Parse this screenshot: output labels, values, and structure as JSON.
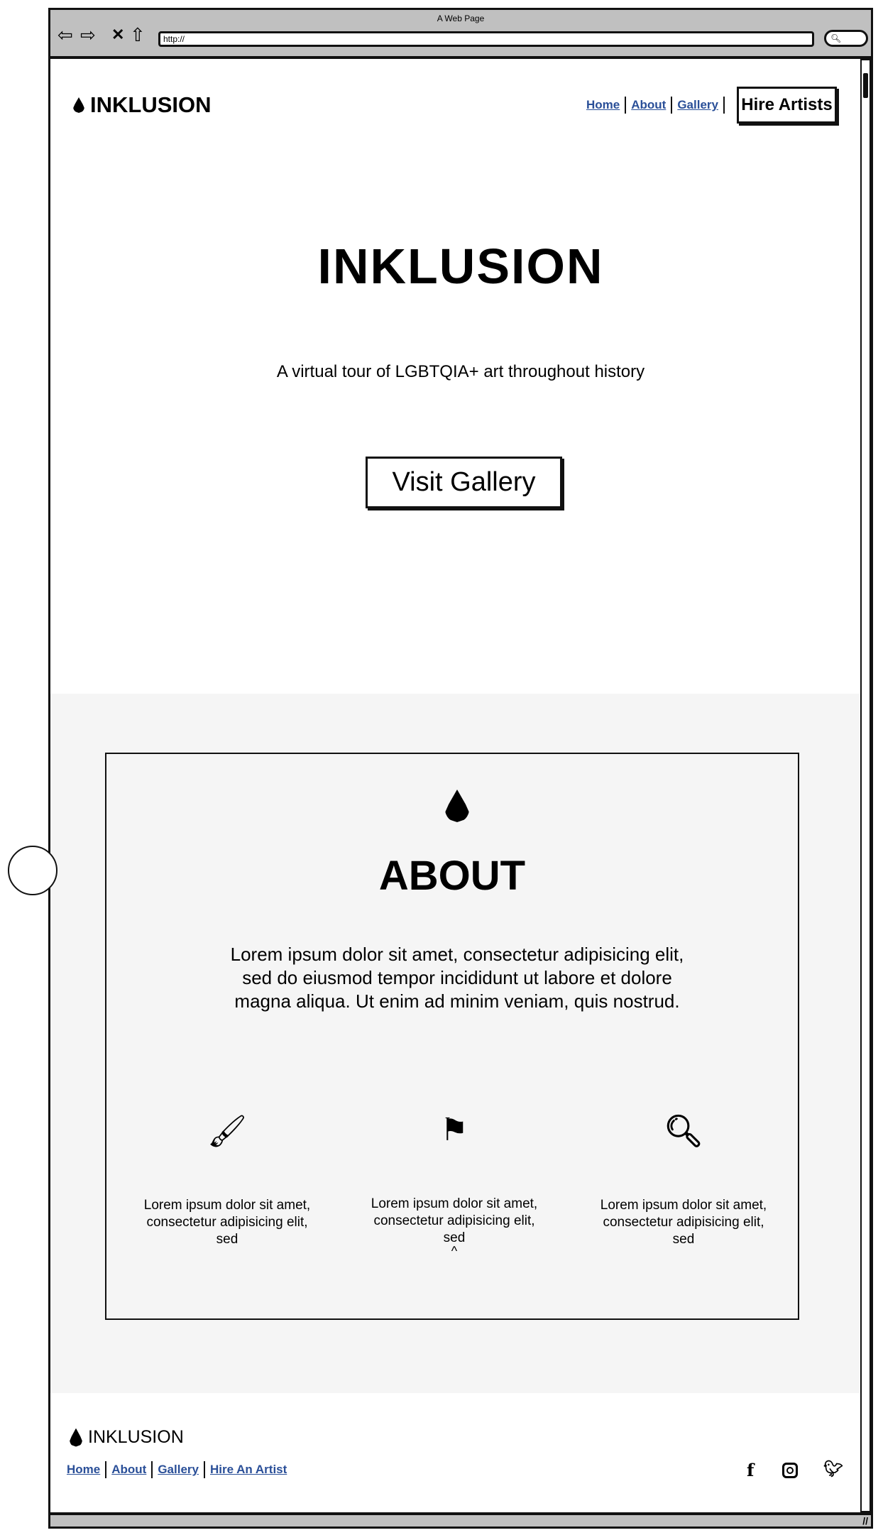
{
  "browser": {
    "title": "A Web Page",
    "url": "http://"
  },
  "header": {
    "logo": "INKLUSION",
    "nav": [
      "Home",
      "About",
      "Gallery"
    ],
    "cta": "Hire Artists"
  },
  "hero": {
    "title": "INKLUSION",
    "subtitle": "A virtual tour of LGBTQIA+ art throughout history",
    "button": "Visit Gallery"
  },
  "about": {
    "title": "ABOUT",
    "text": "Lorem ipsum dolor sit amet, consectetur adipisicing elit, sed do eiusmod tempor incididunt ut labore et dolore magna aliqua. Ut enim ad minim veniam, quis nostrud.",
    "features": [
      {
        "icon": "paintbrush-icon",
        "text": "Lorem ipsum dolor sit amet, consectetur adipisicing elit, sed"
      },
      {
        "icon": "flag-icon",
        "text": "Lorem ipsum dolor sit amet, consectetur adipisicing elit, sed"
      },
      {
        "icon": "search-icon",
        "text": "Lorem ipsum dolor sit amet, consectetur adipisicing elit, sed"
      }
    ]
  },
  "footer": {
    "logo": "INKLUSION",
    "links": [
      "Home",
      "About",
      "Gallery",
      "Hire An Artist"
    ],
    "social": [
      "facebook-icon",
      "instagram-icon",
      "twitter-icon"
    ]
  }
}
